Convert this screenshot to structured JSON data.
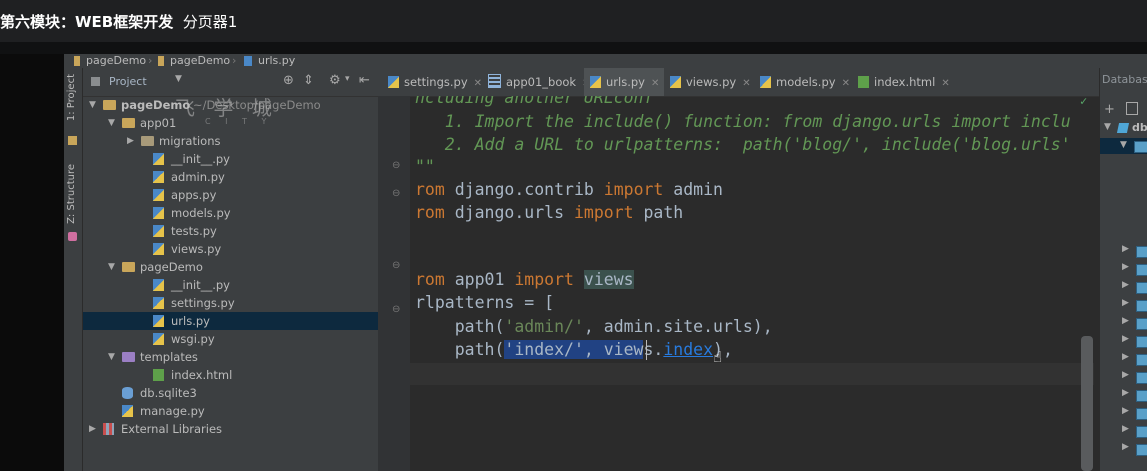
{
  "video": {
    "title_bold": "第六模块：WEB框架开发",
    "title_rest": "分页器1"
  },
  "nav": {
    "crumbs": [
      "pageDemo",
      "pageDemo",
      "urls.py"
    ]
  },
  "side_tabs": {
    "project": "1: Project",
    "structure": "Z: Structure"
  },
  "project_panel": {
    "dropdown": "Project",
    "watermark": "飞 学 城",
    "watermark_sub": "C I T Y"
  },
  "tree": [
    {
      "label": "pageDemo",
      "path": "~/Desktop/pageDemo",
      "kind": "folder",
      "depth": 0,
      "open": true
    },
    {
      "label": "app01",
      "kind": "folder",
      "depth": 1,
      "open": true
    },
    {
      "label": "migrations",
      "kind": "folder-plain",
      "depth": 2,
      "open": false
    },
    {
      "label": "__init__.py",
      "kind": "py",
      "depth": 2
    },
    {
      "label": "admin.py",
      "kind": "py",
      "depth": 2
    },
    {
      "label": "apps.py",
      "kind": "py",
      "depth": 2
    },
    {
      "label": "models.py",
      "kind": "py",
      "depth": 2
    },
    {
      "label": "tests.py",
      "kind": "py",
      "depth": 2
    },
    {
      "label": "views.py",
      "kind": "py",
      "depth": 2
    },
    {
      "label": "pageDemo",
      "kind": "folder",
      "depth": 1,
      "open": true
    },
    {
      "label": "__init__.py",
      "kind": "py",
      "depth": 2
    },
    {
      "label": "settings.py",
      "kind": "py",
      "depth": 2
    },
    {
      "label": "urls.py",
      "kind": "py",
      "depth": 2,
      "selected": true
    },
    {
      "label": "wsgi.py",
      "kind": "py",
      "depth": 2
    },
    {
      "label": "templates",
      "kind": "folder-purple",
      "depth": 1,
      "open": true
    },
    {
      "label": "index.html",
      "kind": "html",
      "depth": 2
    },
    {
      "label": "db.sqlite3",
      "kind": "db",
      "depth": 1
    },
    {
      "label": "manage.py",
      "kind": "py",
      "depth": 1
    },
    {
      "label": "External Libraries",
      "kind": "lib",
      "depth": 0,
      "open": false
    }
  ],
  "tabs": [
    {
      "label": "settings.py",
      "kind": "py",
      "active": false
    },
    {
      "label": "app01_book",
      "kind": "table",
      "active": false
    },
    {
      "label": "urls.py",
      "kind": "py",
      "active": true
    },
    {
      "label": "views.py",
      "kind": "py",
      "active": false
    },
    {
      "label": "models.py",
      "kind": "py",
      "active": false
    },
    {
      "label": "index.html",
      "kind": "html",
      "active": false
    }
  ],
  "code": {
    "l1": "ncluding another URLconf",
    "l2": "   1. Import the include() function: from django.urls import inclu",
    "l3": "   2. Add a URL to urlpatterns:  path('blog/', include('blog.urls'",
    "l4": "\"\"",
    "l5a": "rom",
    "l5b": " django.contrib ",
    "l5c": "import",
    "l5d": " admin",
    "l6a": "rom",
    "l6b": " django.urls ",
    "l6c": "import",
    "l6d": " path",
    "l7a": "rom",
    "l7b": " app01 ",
    "l7c": "import",
    "l7d": "views",
    "l8": "rlpatterns = [",
    "l9a": "    path(",
    "l9b": "'admin/'",
    "l9c": ", admin.site.urls),",
    "l10a": "    path(",
    "l10b": "'index/', view",
    "l10c": "s.",
    "l10d": "index",
    "l10e": "),"
  },
  "db_panel": {
    "title": "Database",
    "root": "db"
  },
  "colors": {
    "bg_ide": "#3c3f41",
    "bg_editor": "#2b2b2b",
    "keyword": "#cc7832",
    "string": "#6a8759",
    "comment": "#629755",
    "selection": "#214283"
  }
}
